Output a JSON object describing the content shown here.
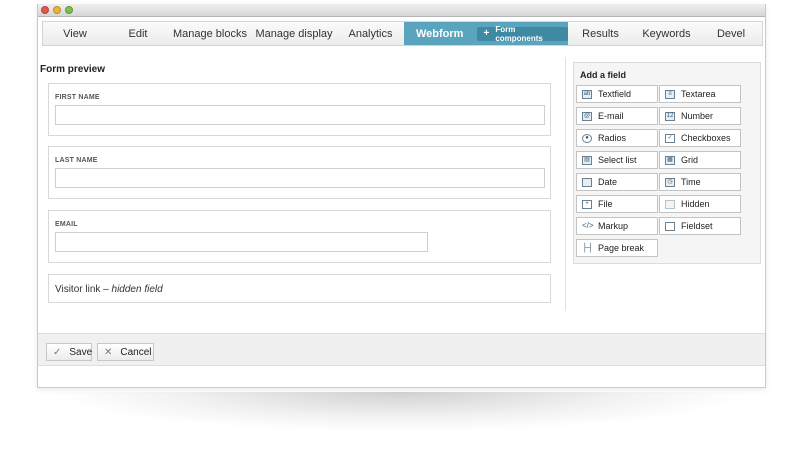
{
  "tabs": [
    {
      "label": "View"
    },
    {
      "label": "Edit"
    },
    {
      "label": "Manage blocks"
    },
    {
      "label": "Manage display"
    },
    {
      "label": "Analytics"
    },
    {
      "label": "Webform",
      "active": true
    },
    {
      "label": "Results"
    },
    {
      "label": "Keywords"
    },
    {
      "label": "Devel"
    }
  ],
  "subtab": {
    "icon": "plus-icon",
    "label": "Form components"
  },
  "preview": {
    "title": "Form preview",
    "fields": [
      {
        "label": "FIRST NAME",
        "value": ""
      },
      {
        "label": "LAST NAME",
        "value": ""
      },
      {
        "label": "EMAIL",
        "value": ""
      }
    ],
    "hidden_field": {
      "name": "Visitor link",
      "separator": " – ",
      "note": "hidden field"
    }
  },
  "palette": {
    "title": "Add a field",
    "items": [
      {
        "label": "Textfield",
        "icon": "textfield-icon"
      },
      {
        "label": "Textarea",
        "icon": "textarea-icon"
      },
      {
        "label": "E-mail",
        "icon": "email-icon"
      },
      {
        "label": "Number",
        "icon": "number-icon"
      },
      {
        "label": "Radios",
        "icon": "radios-icon"
      },
      {
        "label": "Checkboxes",
        "icon": "checkboxes-icon"
      },
      {
        "label": "Select list",
        "icon": "select-list-icon"
      },
      {
        "label": "Grid",
        "icon": "grid-icon"
      },
      {
        "label": "Date",
        "icon": "date-icon"
      },
      {
        "label": "Time",
        "icon": "time-icon"
      },
      {
        "label": "File",
        "icon": "file-icon"
      },
      {
        "label": "Hidden",
        "icon": "hidden-icon"
      },
      {
        "label": "Markup",
        "icon": "markup-icon"
      },
      {
        "label": "Fieldset",
        "icon": "fieldset-icon"
      },
      {
        "label": "Page break",
        "icon": "page-break-icon"
      }
    ]
  },
  "footer": {
    "save": {
      "label": "Save",
      "icon": "check-icon"
    },
    "cancel": {
      "label": "Cancel",
      "icon": "close-icon"
    }
  },
  "colors": {
    "accent": "#5aa5bd",
    "accent_dark": "#3f8aa3"
  }
}
